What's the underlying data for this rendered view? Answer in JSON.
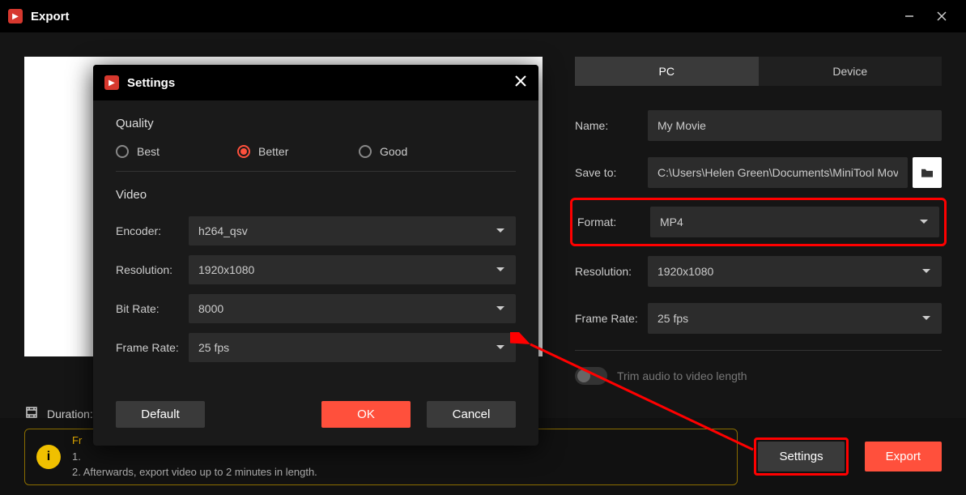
{
  "window": {
    "title": "Export"
  },
  "tabs": {
    "pc": "PC",
    "device": "Device"
  },
  "fields": {
    "name_label": "Name:",
    "name_value": "My Movie",
    "saveto_label": "Save to:",
    "saveto_value": "C:\\Users\\Helen Green\\Documents\\MiniTool MovieM",
    "format_label": "Format:",
    "format_value": "MP4",
    "resolution_label": "Resolution:",
    "resolution_value": "1920x1080",
    "framerate_label": "Frame Rate:",
    "framerate_value": "25 fps"
  },
  "trim_label": "Trim audio to video length",
  "duration_label": "Duration:",
  "notice": {
    "heading": "Fr",
    "line1": "1.",
    "line2": "2. Afterwards, export video up to 2 minutes in length."
  },
  "buttons": {
    "settings": "Settings",
    "export": "Export"
  },
  "modal": {
    "title": "Settings",
    "quality_heading": "Quality",
    "radio_best": "Best",
    "radio_better": "Better",
    "radio_good": "Good",
    "video_heading": "Video",
    "encoder_label": "Encoder:",
    "encoder_value": "h264_qsv",
    "resolution_label": "Resolution:",
    "resolution_value": "1920x1080",
    "bitrate_label": "Bit Rate:",
    "bitrate_value": "8000",
    "framerate_label": "Frame Rate:",
    "framerate_value": "25 fps",
    "default_btn": "Default",
    "ok_btn": "OK",
    "cancel_btn": "Cancel"
  }
}
